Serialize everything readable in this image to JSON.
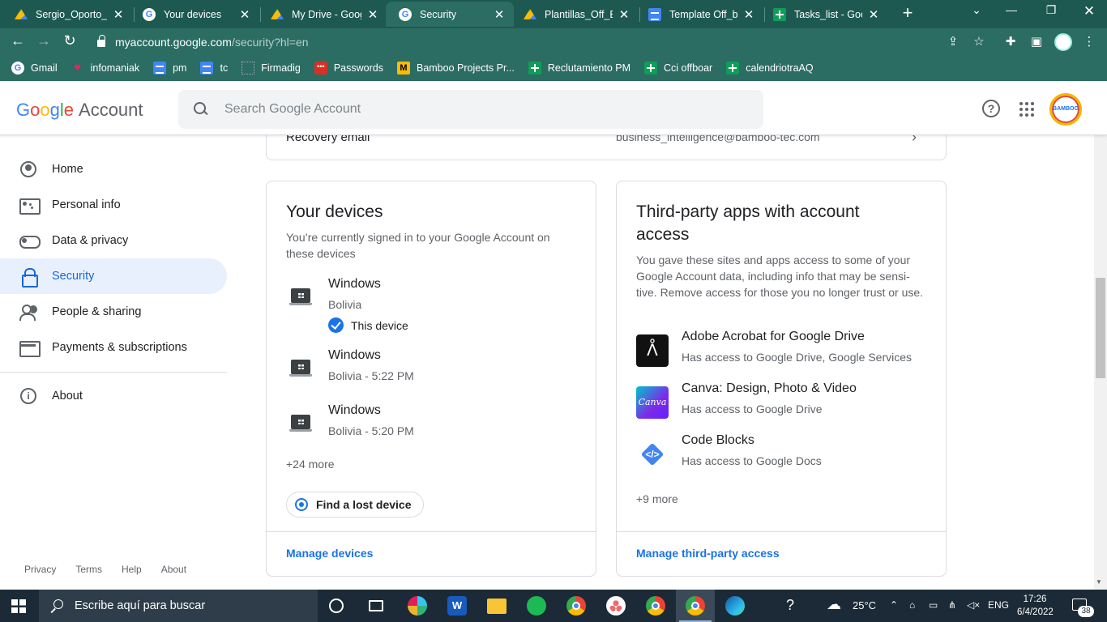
{
  "browser": {
    "tabs": [
      {
        "title": "Sergio_Oporto_of",
        "icon": "drive"
      },
      {
        "title": "Your devices",
        "icon": "google"
      },
      {
        "title": "My Drive - Googl",
        "icon": "drive"
      },
      {
        "title": "Security",
        "icon": "google",
        "active": true
      },
      {
        "title": "Plantillas_Off_Bo",
        "icon": "drive"
      },
      {
        "title": "Template Off_bo",
        "icon": "docs"
      },
      {
        "title": "Tasks_list - Goog",
        "icon": "sheets"
      }
    ],
    "url_host": "myaccount.google.com",
    "url_path": "/security?hl=en",
    "bookmarks": [
      {
        "label": "Gmail",
        "icon": "google"
      },
      {
        "label": "infomaniak",
        "icon": "heart"
      },
      {
        "label": "pm",
        "icon": "docs"
      },
      {
        "label": "tc",
        "icon": "docs"
      },
      {
        "label": "Firmadig",
        "icon": "dots"
      },
      {
        "label": "Passwords",
        "icon": "lastpass"
      },
      {
        "label": "Bamboo Projects Pr...",
        "icon": "bamboo"
      },
      {
        "label": "Reclutamiento PM",
        "icon": "sheets"
      },
      {
        "label": "Cci offboar",
        "icon": "sheets"
      },
      {
        "label": "calendriotraAQ",
        "icon": "sheets"
      }
    ]
  },
  "header": {
    "logo_google": "Google",
    "logo_account": "Account",
    "search_placeholder": "Search Google Account",
    "avatar_text": "BAMBOO"
  },
  "sidebar": {
    "items": [
      {
        "label": "Home",
        "icon": "home-icon"
      },
      {
        "label": "Personal info",
        "icon": "id-card-icon"
      },
      {
        "label": "Data & privacy",
        "icon": "toggle-icon"
      },
      {
        "label": "Security",
        "icon": "lock-icon",
        "active": true
      },
      {
        "label": "People & sharing",
        "icon": "people-icon"
      },
      {
        "label": "Payments & subscriptions",
        "icon": "card-icon"
      },
      {
        "label": "About",
        "icon": "info-icon"
      }
    ],
    "footer": [
      "Privacy",
      "Terms",
      "Help",
      "About"
    ]
  },
  "recovery": {
    "label": "Recovery email",
    "value": "business_intelligence@bamboo-tec.com"
  },
  "devices_card": {
    "title": "Your devices",
    "description": "You’re currently signed in to your Google Account on these devices",
    "devices": [
      {
        "name": "Windows",
        "detail": "Bolivia",
        "this_device": "This device"
      },
      {
        "name": "Windows",
        "detail": "Bolivia - 5:22 PM"
      },
      {
        "name": "Windows",
        "detail": "Bolivia - 5:20 PM"
      }
    ],
    "more": "+24 more",
    "find_button": "Find a lost device",
    "manage_link": "Manage devices"
  },
  "apps_card": {
    "title": "Third-party apps with account access",
    "description": "You gave these sites and apps access to some of your Google Account data, including info that may be sensi-tive. Remove access for those you no longer trust or use.",
    "apps": [
      {
        "name": "Adobe Acrobat for Google Drive",
        "access": "Has access to Google Drive, Google Services",
        "icon": "adobe-acrobat-icon"
      },
      {
        "name": "Canva: Design, Photo & Video",
        "access": "Has access to Google Drive",
        "icon": "canva-icon",
        "icon_text": "Canva"
      },
      {
        "name": "Code Blocks",
        "access": "Has access to Google Docs",
        "icon": "code-blocks-icon"
      }
    ],
    "more": "+9 more",
    "manage_link": "Manage third-party access"
  },
  "taskbar": {
    "search_placeholder": "Escribe aquí para buscar",
    "weather": "25°C",
    "language": "ENG",
    "time": "17:26",
    "date": "6/4/2022",
    "notifications": "38"
  },
  "colors": {
    "chrome_frame": "#1d5951",
    "chrome_toolbar": "#2b6c63",
    "accent_blue": "#1a73e8",
    "active_nav_bg": "#e8f0fe"
  }
}
